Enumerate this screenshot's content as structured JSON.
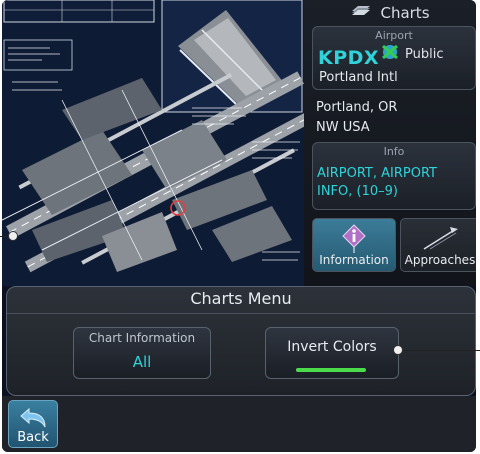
{
  "header": {
    "title": "Charts"
  },
  "airport": {
    "caption": "Airport",
    "ident": "KPDX",
    "type": "Public",
    "name": "Portland Intl",
    "city": "Portland, OR",
    "region": "NW USA"
  },
  "info": {
    "caption": "Info",
    "line1": "AIRPORT, AIRPORT",
    "line2": "INFO, (10–9)"
  },
  "tabs": [
    {
      "label": "Information",
      "selected": true
    },
    {
      "label": "Approaches",
      "selected": false
    }
  ],
  "menu": {
    "title": "Charts Menu",
    "chart_info": {
      "caption": "Chart Information",
      "value": "All"
    },
    "invert": {
      "label": "Invert Colors",
      "on": true
    }
  },
  "bottom": {
    "back_label": "Back"
  },
  "colors": {
    "accent": "#2fd3d8",
    "indicator": "#4bdc4b",
    "selected_tab": "#3c7c98"
  }
}
